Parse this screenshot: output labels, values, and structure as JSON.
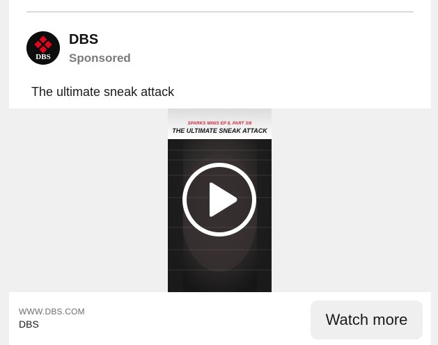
{
  "post": {
    "advertiser": "DBS",
    "sponsored_label": "Sponsored",
    "caption": "The ultimate sneak attack",
    "avatar_logo_text": "DBS",
    "brand_color": "#e1051e"
  },
  "video": {
    "subtitle": "SPARKS MINIS EP 8, PART 3/6",
    "title": "THE ULTIMATE SNEAK ATTACK",
    "play_icon": "play-icon"
  },
  "footer": {
    "domain": "WWW.DBS.COM",
    "name": "DBS",
    "cta_label": "Watch more"
  }
}
